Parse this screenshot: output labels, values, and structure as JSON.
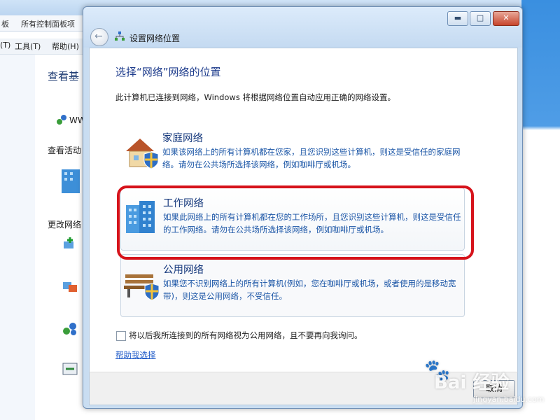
{
  "background_window": {
    "address_fragments": [
      "板",
      "所有控制面板项"
    ],
    "menu": [
      "(T)",
      "工具(T)",
      "帮助(H)"
    ],
    "page_heading_fragment": "查看基",
    "network_name_fragment": "WW",
    "active_networks_fragment": "查看活动",
    "change_settings_fragment": "更改网络"
  },
  "dialog": {
    "title": "设置网络位置",
    "window_buttons": {
      "minimize": "▬",
      "maximize": "□",
      "close": "✕"
    },
    "heading": "选择“网络”网络的位置",
    "intro": "此计算机已连接到网络，Windows 将根据网络位置自动应用正确的网络设置。",
    "options": [
      {
        "title": "家庭网络",
        "description": "如果该网络上的所有计算机都在您家，且您识别这些计算机，则这是受信任的家庭网络。请勿在公共场所选择该网络，例如咖啡厅或机场。",
        "icon": "house-shield-icon"
      },
      {
        "title": "工作网络",
        "description": "如果此网络上的所有计算机都在您的工作场所，且您识别这些计算机，则这是受信任的工作网络。请勿在公共场所选择该网络，例如咖啡厅或机场。",
        "icon": "office-building-icon"
      },
      {
        "title": "公用网络",
        "description": "如果您不识别网络上的所有计算机(例如，您在咖啡厅或机场，或者使用的是移动宽带)，则这是公用网络，不受信任。",
        "icon": "park-bench-shield-icon"
      }
    ],
    "checkbox_label": "将以后我所连接到的所有网络视为公用网络，且不要再向我询问。",
    "help_link": "帮助我选择",
    "cancel_label": "取消"
  },
  "watermark": {
    "main": "Bai 经验",
    "sub": "jingyan.baidu.com"
  },
  "colors": {
    "heading": "#1e3c8c",
    "link": "#1b57c7",
    "highlight": "#d6131b"
  }
}
